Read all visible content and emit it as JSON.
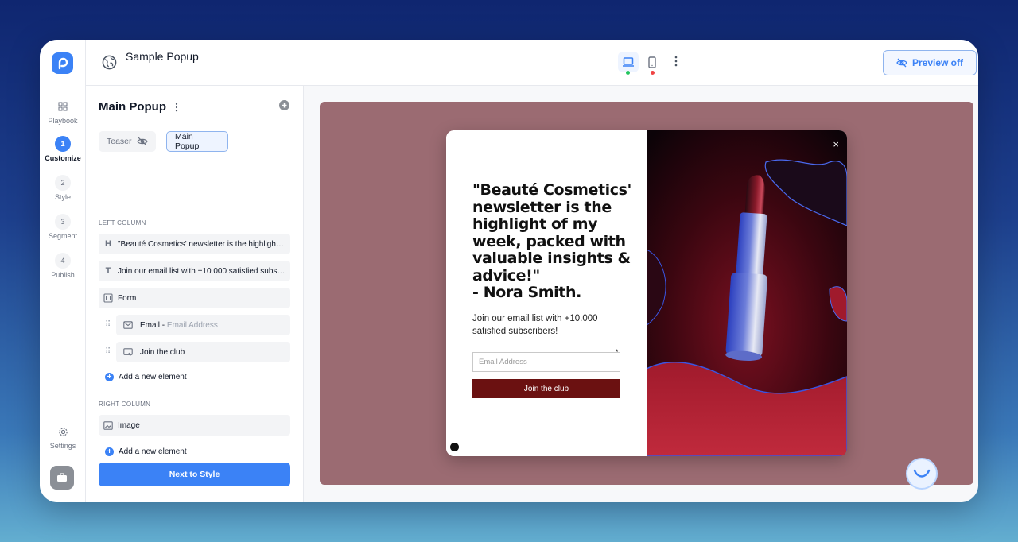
{
  "app": {
    "title": "Sample Popup",
    "preview_label": "Preview off"
  },
  "nav": {
    "items": [
      {
        "label": "Playbook",
        "badge": ""
      },
      {
        "label": "Customize",
        "badge": "1"
      },
      {
        "label": "Style",
        "badge": "2"
      },
      {
        "label": "Segment",
        "badge": "3"
      },
      {
        "label": "Publish",
        "badge": "4"
      }
    ],
    "settings_label": "Settings"
  },
  "devices": {
    "desktop_status_color": "#22c55e",
    "mobile_status_color": "#ef4444"
  },
  "panel": {
    "title": "Main Popup",
    "tabs": {
      "teaser": "Teaser",
      "main": "Main Popup"
    },
    "left_column_label": "LEFT COLUMN",
    "left_items": [
      {
        "icon": "H",
        "text": "\"Beauté Cosmetics' newsletter is the highlight of my week, packed with valuable insights & advice!\""
      },
      {
        "icon": "T",
        "text": "Join our email list with +10.000 satisfied subscribers!"
      },
      {
        "icon": "form-icon",
        "text": "Form"
      }
    ],
    "form_fields": [
      {
        "label": "Email - ",
        "hint": "Email Address"
      },
      {
        "label": "Join the club",
        "hint": ""
      }
    ],
    "add_element_label": "Add a new element",
    "right_column_label": "RIGHT COLUMN",
    "right_items": [
      {
        "icon": "image-icon",
        "text": "Image"
      }
    ],
    "next_button": "Next to Style"
  },
  "popup": {
    "headline": "\"Beauté Cosmetics' newsletter is the highlight of my week, packed with valuable insights & advice!\"\n- Nora Smith.",
    "subtext": "Join our email list with +10.000 satisfied subscribers!",
    "email_placeholder": "Email Address",
    "required_mark": "*",
    "cta": "Join the club",
    "close": "×",
    "accent_color": "#6b1111",
    "stage_color": "#9b6b72"
  }
}
